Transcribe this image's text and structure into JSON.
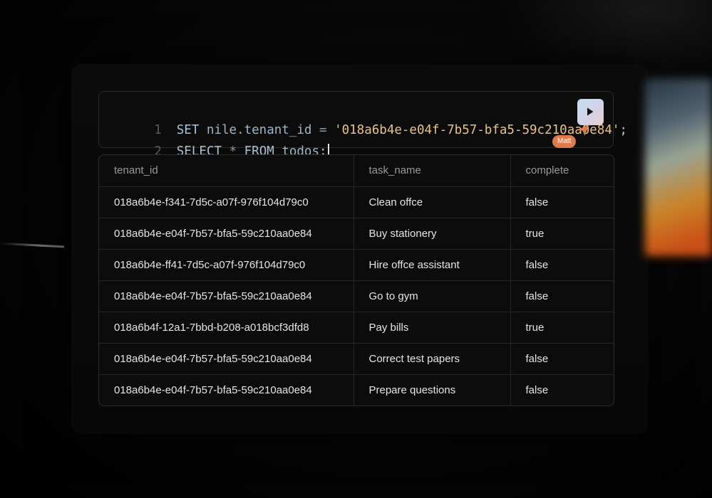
{
  "editor": {
    "line1_number": "1",
    "line1_set": "SET",
    "line1_ident": "nile.tenant_id",
    "line1_op": "=",
    "line1_value": "'018a6b4e-e04f-7b57-bfa5-59c210aa0e84'",
    "line1_end": ";",
    "line2_number": "2",
    "line2_select": "SELECT",
    "line2_star": "*",
    "line2_from": "FROM",
    "line2_table": "todos",
    "line2_end": ";"
  },
  "run_button": {
    "icon": "play-icon",
    "color": "#bfe0ef"
  },
  "collaborator": {
    "name": "Matt",
    "color": "#e07a4a"
  },
  "results": {
    "columns": [
      "tenant_id",
      "task_name",
      "complete"
    ],
    "rows": [
      [
        "018a6b4e-f341-7d5c-a07f-976f104d79c0",
        "Clean offce",
        "false"
      ],
      [
        "018a6b4e-e04f-7b57-bfa5-59c210aa0e84",
        "Buy stationery",
        "true"
      ],
      [
        "018a6b4e-ff41-7d5c-a07f-976f104d79c0",
        "Hire offce assistant",
        "false"
      ],
      [
        "018a6b4e-e04f-7b57-bfa5-59c210aa0e84",
        "Go to gym",
        "false"
      ],
      [
        "018a6b4f-12a1-7bbd-b208-a018bcf3dfd8",
        "Pay bills",
        "true"
      ],
      [
        "018a6b4e-e04f-7b57-bfa5-59c210aa0e84",
        "Correct test papers",
        "false"
      ],
      [
        "018a6b4e-e04f-7b57-bfa5-59c210aa0e84",
        "Prepare questions",
        "false"
      ]
    ]
  }
}
